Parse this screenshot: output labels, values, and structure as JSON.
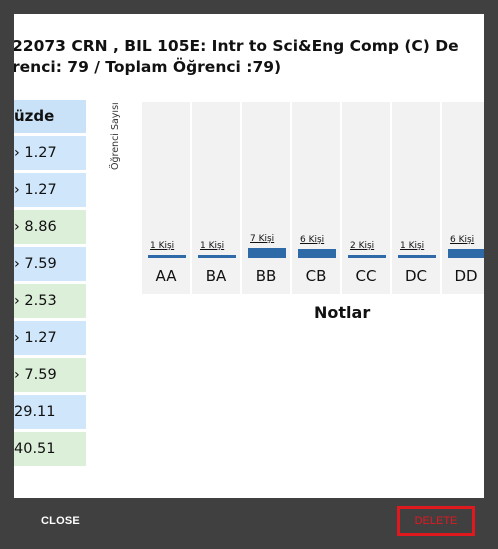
{
  "dialog": {
    "title_line1": "22073 CRN , BIL 105E: Intr to Sci&Eng Comp (C) De",
    "title_line2": "renci: 79 / Toplam Öğrenci :79)"
  },
  "table": {
    "header": "üzde",
    "rows": [
      {
        "value": "› 1.27",
        "color": "blue"
      },
      {
        "value": "› 1.27",
        "color": "blue"
      },
      {
        "value": "› 8.86",
        "color": "green"
      },
      {
        "value": "› 7.59",
        "color": "blue"
      },
      {
        "value": "› 2.53",
        "color": "green"
      },
      {
        "value": "› 1.27",
        "color": "blue"
      },
      {
        "value": "› 7.59",
        "color": "green"
      },
      {
        "value": " 29.11",
        "color": "blue"
      },
      {
        "value": " 40.51",
        "color": "green"
      }
    ]
  },
  "chart_data": {
    "type": "bar",
    "categories": [
      "AA",
      "BA",
      "BB",
      "CB",
      "CC",
      "DC",
      "DD"
    ],
    "values": [
      1,
      1,
      7,
      6,
      2,
      1,
      6
    ],
    "data_labels": [
      "1 Kişi",
      "1 Kişi",
      "7 Kişi",
      "6 Kişi",
      "2 Kişi",
      "1 Kişi",
      "6 Kişi"
    ],
    "xlabel": "Notlar",
    "ylabel": "Öğrenci Sayısı",
    "bar_color": "#2e69a8",
    "grid": false
  },
  "footer": {
    "close_label": "CLOSE",
    "delete_label": "DELETE"
  }
}
